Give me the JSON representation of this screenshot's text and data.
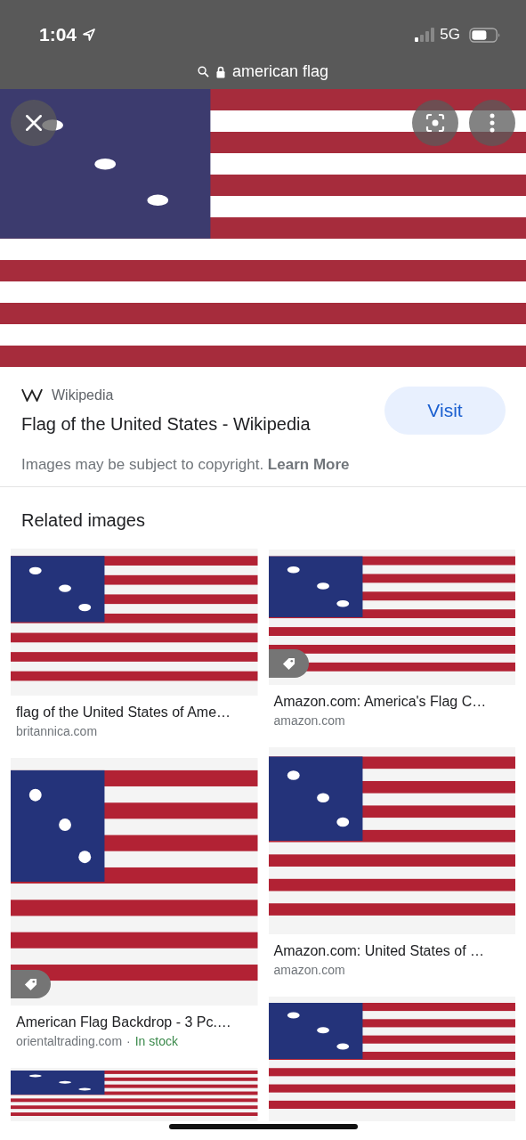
{
  "status_bar": {
    "time": "1:04",
    "network": "5G"
  },
  "address_bar": {
    "query": "american flag"
  },
  "result": {
    "source": "Wikipedia",
    "title": "Flag of the United States - Wikipedia",
    "button": "Visit",
    "notice": "Images may be subject to copyright. **Learn More**"
  },
  "related": {
    "heading": "Related images",
    "columns": [
      [
        {
          "caption": "flag of the United States of Ame…",
          "source": "britannica.com",
          "tag": false
        },
        {
          "caption": "American Flag Backdrop - 3 Pc.…",
          "source": "orientaltrading.com",
          "separator": "·",
          "availability": "In stock",
          "tag": true
        },
        {
          "tag": false
        }
      ],
      [
        {
          "caption": "Amazon.com: America's Flag C…",
          "source": "amazon.com",
          "tag": true
        },
        {
          "caption": "Amazon.com: United States of …",
          "source": "amazon.com",
          "tag": false
        },
        {
          "tag": false
        }
      ]
    ]
  }
}
